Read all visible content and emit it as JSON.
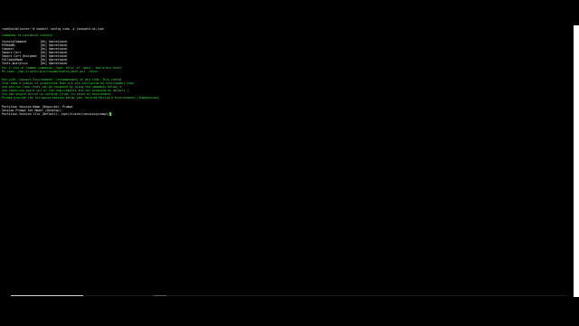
{
  "terminal": {
    "prompt_line": "root@coldcluster:~# kubectl config view -o jsonpath-as-json",
    "green_line_1": "Commands to customize console",
    "status_rows": [
      "ConsoleCommand        [Ok] Operational",
      "PSReadRL              [Ok] Operational",
      "Compact               [Ok] Operational",
      "Import-Cert           [Ok] Operational",
      "Import-Cert Unsigned  [Ok] Operational",
      "FallbackMode          [Ok] Operational",
      "Tests-Analytics       [Ok] Operational"
    ],
    "green_block_1": [
      "For a list of common commands, type 'help' or 'menu', and press enter",
      "PS root: /opt/cluster/bin/resume/status/path.ps1 -force"
    ],
    "green_block_2": [
      "Run with 'Connect-Environment' (recommended) at any time. This checks",
      "that some a subset of properties that are pre-configured by environment have",
      "and pre-run load (they can be reviewed by using the commands below) a",
      "and resources point out of the requirements are not produced by default.)",
      "You can ensure active us nothing (from) to value of environment."
    ],
    "green_line_3": "Please provide the following session below your desired Multiple Environments (Submissions).",
    "white_block": [
      "Partition Session Name (Required): Prompt",
      "Session Prompt Set Model (Desktop):",
      "Partition Session file (Default): /opt/cluster/session/prompt/"
    ]
  },
  "video": {
    "progress_fraction": 0.13
  },
  "colors": {
    "background": "#000000",
    "terminal_green": "#3ddc3d",
    "terminal_text": "#e8e8e8"
  }
}
